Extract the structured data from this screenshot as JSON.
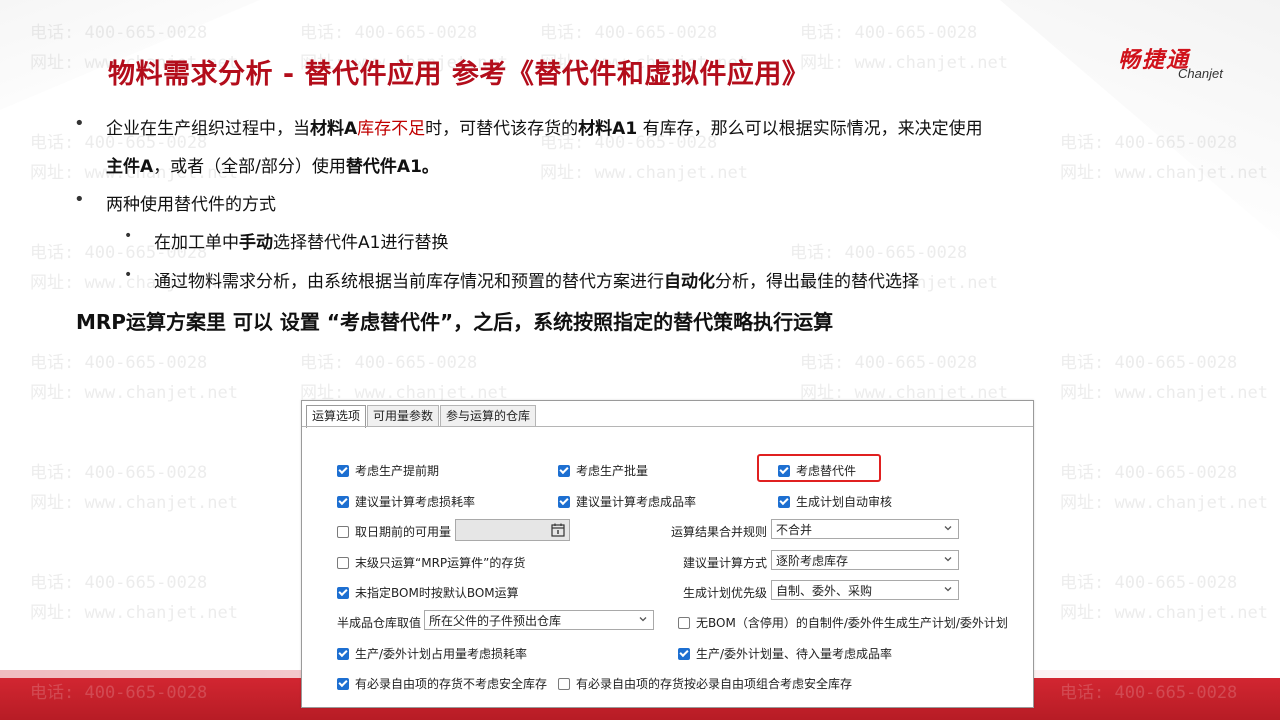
{
  "watermark": {
    "phone": "电话: 400-665-0028",
    "site": "网址: www.chanjet.net"
  },
  "title": "物料需求分析 - 替代件应用  参考《替代件和虚拟件应用》",
  "logo": {
    "cn": "畅捷通",
    "en": "Chanjet"
  },
  "bullet_char": "•",
  "para1": {
    "a": "企业在生产组织过程中，当",
    "b": "材料A",
    "c": "库存不足",
    "d": "时，可替代该存货的",
    "e": "材料A1",
    "f": " 有库存，那么可以根据实际情况，来决定使用",
    "line2_b": "主件A",
    "line2_c": "，或者（全部/部分）使用",
    "line2_d": "替代件A1。"
  },
  "para2": "两种使用替代件的方式",
  "sub1": {
    "a": "在加工单中",
    "b": "手动",
    "c": "选择替代件A1进行替换"
  },
  "sub2": {
    "a": "通过物料需求分析，由系统根据当前库存情况和预置的替代方案进行",
    "b": "自动化",
    "c": "分析，得出最佳的替代选择"
  },
  "mrp_line": "MRP运算方案里 可以 设置 “考虑替代件”，之后，系统按照指定的替代策略执行运算",
  "dialog": {
    "tabs": [
      "运算选项",
      "可用量参数",
      "参与运算的仓库"
    ],
    "options": {
      "lead_time": "考虑生产提前期",
      "batch": "考虑生产批量",
      "substitute": "考虑替代件",
      "loss_rate": "建议量计算考虑损耗率",
      "yield_rate": "建议量计算考虑成品率",
      "auto_audit": "生成计划自动审核",
      "prior_date": "取日期前的可用量",
      "last_level": "末级只运算“MRP运算件”的存货",
      "default_bom": "未指定BOM时按默认BOM运算",
      "no_bom": "无BOM（含停用）的自制件/委外件生成生产计划/委外计划",
      "plan_loss": "生产/委外计划占用量考虑损耗率",
      "plan_yield": "生产/委外计划量、待入量考虑成品率",
      "free_no_safety": "有必录自由项的存货不考虑安全库存",
      "free_combo_safety": "有必录自由项的存货按必录自由项组合考虑安全库存"
    },
    "labels": {
      "merge_rule": "运算结果合并规则",
      "calc_method": "建议量计算方式",
      "priority": "生成计划优先级",
      "semi_wh": "半成品仓库取值"
    },
    "selects": {
      "merge_rule": "不合并",
      "calc_method": "逐阶考虑库存",
      "priority": "自制、委外、采购",
      "semi_wh": "所在父件的子件预出仓库"
    }
  }
}
